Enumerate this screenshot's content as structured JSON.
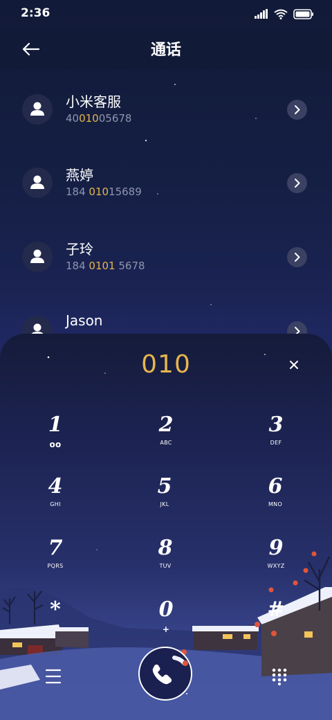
{
  "status": {
    "time": "2:36"
  },
  "header": {
    "title": "通话"
  },
  "contacts": [
    {
      "name": "小米客服",
      "num_pre": "40",
      "num_hl": "010",
      "num_post": "05678"
    },
    {
      "name": "燕婷",
      "num_pre": "184 ",
      "num_hl": "010",
      "num_post": "15689"
    },
    {
      "name": "子玲",
      "num_pre": "184 ",
      "num_hl": "0101",
      "num_post": " 5678"
    },
    {
      "name": "Jason",
      "num_pre": "",
      "num_hl": "",
      "num_post": ""
    }
  ],
  "dialpad": {
    "number": "010",
    "keys": [
      {
        "digit": "1",
        "letters": "oo"
      },
      {
        "digit": "2",
        "letters": "ABC"
      },
      {
        "digit": "3",
        "letters": "DEF"
      },
      {
        "digit": "4",
        "letters": "GHI"
      },
      {
        "digit": "5",
        "letters": "JKL"
      },
      {
        "digit": "6",
        "letters": "MNO"
      },
      {
        "digit": "7",
        "letters": "PQRS"
      },
      {
        "digit": "8",
        "letters": "TUV"
      },
      {
        "digit": "9",
        "letters": "WXYZ"
      },
      {
        "digit": "*",
        "letters": ""
      },
      {
        "digit": "0",
        "letters": "+"
      },
      {
        "digit": "#",
        "letters": ""
      }
    ]
  },
  "colors": {
    "accent": "#e6b54d",
    "background": "#1a2352",
    "header": "#111a37",
    "secondary_text": "#8f95ae"
  },
  "icons": {
    "back": "back-arrow-icon",
    "contact": "person-icon",
    "detail": "chevron-right-icon",
    "clear": "close-icon",
    "menu": "menu-icon",
    "call": "phone-icon",
    "keypad": "dialpad-icon"
  }
}
